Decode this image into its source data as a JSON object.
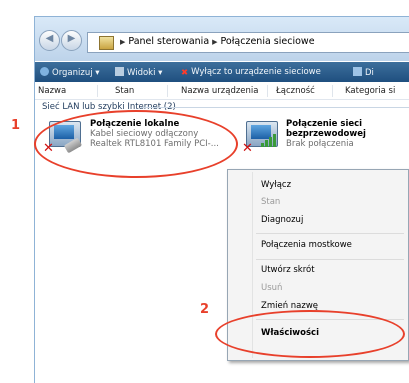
{
  "address": {
    "crumbs": [
      "Panel sterowania",
      "Połączenia sieciowe"
    ]
  },
  "toolbar": {
    "organize": "Organizuj",
    "views": "Widoki",
    "disable": "Wyłącz to urządzenie sieciowe",
    "next": "Di"
  },
  "columns": [
    "Nazwa",
    "Stan",
    "Nazwa urządzenia",
    "Łączność",
    "Kategoria si"
  ],
  "group": {
    "label": "Sieć LAN lub szybki Internet (2)"
  },
  "connections": [
    {
      "name": "Połączenie lokalne",
      "status": "Kabel sieciowy odłączony",
      "device": "Realtek RTL8101 Family PCI-..."
    },
    {
      "name_line1": "Połączenie sieci",
      "name_line2": "bezprzewodowej",
      "status": "Brak połączenia"
    }
  ],
  "context_menu": {
    "items": [
      {
        "label": "Wyłącz",
        "state": "normal"
      },
      {
        "label": "Stan",
        "state": "disabled"
      },
      {
        "label": "Diagnozuj",
        "state": "normal"
      },
      {
        "label": "Połączenia mostkowe",
        "state": "normal"
      },
      {
        "label": "Utwórz skrót",
        "state": "normal"
      },
      {
        "label": "Usuń",
        "state": "disabled"
      },
      {
        "label": "Zmień nazwę",
        "state": "normal"
      },
      {
        "label": "Właściwości",
        "state": "bold"
      }
    ]
  },
  "annotations": {
    "step1": "1",
    "step2": "2"
  },
  "colors": {
    "accent": "#e8402b",
    "toolbar": "#1f4f7f"
  },
  "icons": [
    "network-adapter-icon",
    "wireless-adapter-icon",
    "disconnected-x-icon",
    "signal-bars-icon"
  ]
}
